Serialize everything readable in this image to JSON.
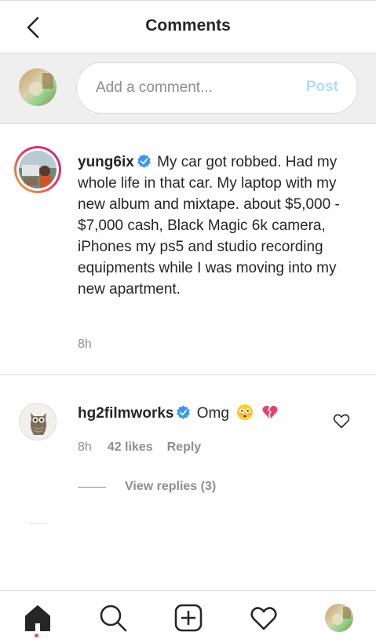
{
  "header": {
    "title": "Comments",
    "back_icon": "chevron-left-icon"
  },
  "composer": {
    "placeholder": "Add a comment...",
    "post_label": "Post",
    "post_color": "#b3dbff"
  },
  "caption": {
    "username": "yung6ix",
    "verified": true,
    "text": "My car got robbed. Had my whole life in that car. My laptop with my new album and mixtape. about $5,000 - $7,000 cash, Black Magic 6k camera, iPhones my ps5 and studio recording equipments while I was moving into my new apartment.",
    "time": "8h"
  },
  "comments": [
    {
      "username": "hg2filmworks",
      "verified": true,
      "text": "Omg",
      "emojis": [
        "flushed-face-emoji",
        "broken-heart-emoji"
      ],
      "time": "8h",
      "likes": "42 likes",
      "reply_label": "Reply",
      "view_replies": "View replies (3)"
    }
  ],
  "bottom_nav": {
    "items": [
      "home-icon",
      "search-icon",
      "new-post-icon",
      "activity-heart-icon",
      "profile-avatar"
    ],
    "active": "home-icon",
    "notification_color": "#ed4956"
  },
  "colors": {
    "verified_blue": "#3897f0",
    "secondary_text": "#8e8e8e",
    "divider": "#dbdbdb"
  }
}
